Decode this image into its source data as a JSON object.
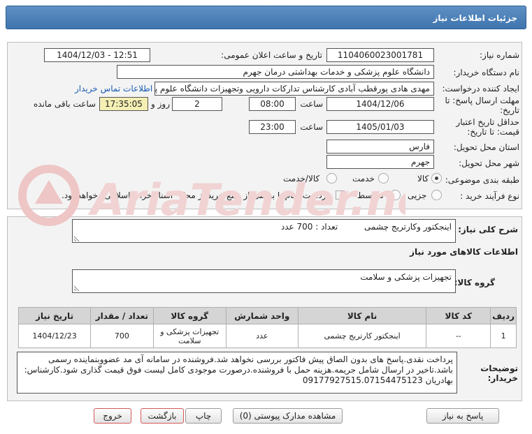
{
  "header": {
    "title": "جزئیات اطلاعات نیاز"
  },
  "form": {
    "need_number_label": "شماره نیاز:",
    "need_number": "1104060023001781",
    "announce_label": "تاریخ و ساعت اعلان عمومی:",
    "announce_value": "1404/12/03 - 12:51",
    "buyer_label": "نام دستگاه خریدار:",
    "buyer_value": "دانشگاه علوم پزشکی و خدمات بهداشتی  درمان جهرم",
    "creator_label": "ایجاد کننده درخواست:",
    "creator_value": "مهدی هادی پورقطب آبادی کارشناس تدارکات دارویی وتجهیزات دانشگاه علوم پز",
    "contact_link": "اطلاعات تماس خریدار",
    "deadline_label_1": "مهلت ارسال پاسخ: تا",
    "deadline_label_2": "تاریخ:",
    "deadline_date": "1404/12/06",
    "time_label": "ساعت",
    "deadline_time": "08:00",
    "days_value": "2",
    "days_label": "روز و",
    "remaining_time": "17:35:05",
    "remaining_label": "ساعت باقی مانده",
    "validity_label_1": "حداقل تاریخ اعتبار",
    "validity_label_2": "قیمت: تا تاریخ:",
    "validity_date": "1405/01/03",
    "validity_time": "23:00",
    "province_label": "استان محل تحویل:",
    "province_value": "فارس",
    "city_label": "شهر محل تحویل:",
    "city_value": "جهرم",
    "category_label": "طبقه بندی موضوعی:",
    "category_options": [
      "کالا",
      "خدمت",
      "کالا/خدمت"
    ],
    "process_label": "نوع فرآیند خرید :",
    "process_options": [
      "جزیی",
      "متوسط"
    ],
    "payment_note": "پرداخت تمام یا بخشی از مبلغ خرید،از محل \"اسناد خزانه اسلامی\" خواهد بود."
  },
  "summary": {
    "label": "شرح کلی نیاز:",
    "value": "اینجکتور وکارتریج چشمی",
    "qty_text": "تعداد : 700 عدد"
  },
  "goods_info": {
    "section_title": "اطلاعات کالاهای مورد نیاز",
    "group_label": "گروه کالا:",
    "group_value": "تجهیزات پزشکی و سلامت"
  },
  "table": {
    "headers": [
      "ردیف",
      "کد کالا",
      "نام کالا",
      "واحد شمارش",
      "گروه کالا",
      "تعداد / مقدار",
      "تاریخ نیاز"
    ],
    "rows": [
      [
        "1",
        "--",
        "اینجکتور کارتریج چشمی",
        "عدد",
        "تجهیزات پزشکی و سلامت",
        "700",
        "1404/12/23"
      ]
    ]
  },
  "notes": {
    "label_1": "توضیحات",
    "label_2": "خریدار:",
    "text": "پرداخت نقدی.پاسخ های بدون الصاق پیش فاکتور بررسی نخواهد شد.فروشنده در سامانه آی مد عضووبنماینده رسمی باشد.تاخیر در ارسال شامل جریمه.هزینه حمل با فروشنده.درصورت موجودی کامل لیست فوق قیمت گذاری شود.کارشناس: بهادریان 09177927515.07154475123"
  },
  "buttons": {
    "reply": "پاسخ به نیاز",
    "attachments": "مشاهده مدارک پیوستی (0)",
    "print": "چاپ",
    "back": "بازگشت",
    "exit": "خروج"
  },
  "watermark": {
    "text": "AriaTender.neT"
  },
  "colors": {
    "title_bar": "#4a7fb8",
    "link": "#1a5cb4",
    "watermark": "#e8a0a0"
  }
}
